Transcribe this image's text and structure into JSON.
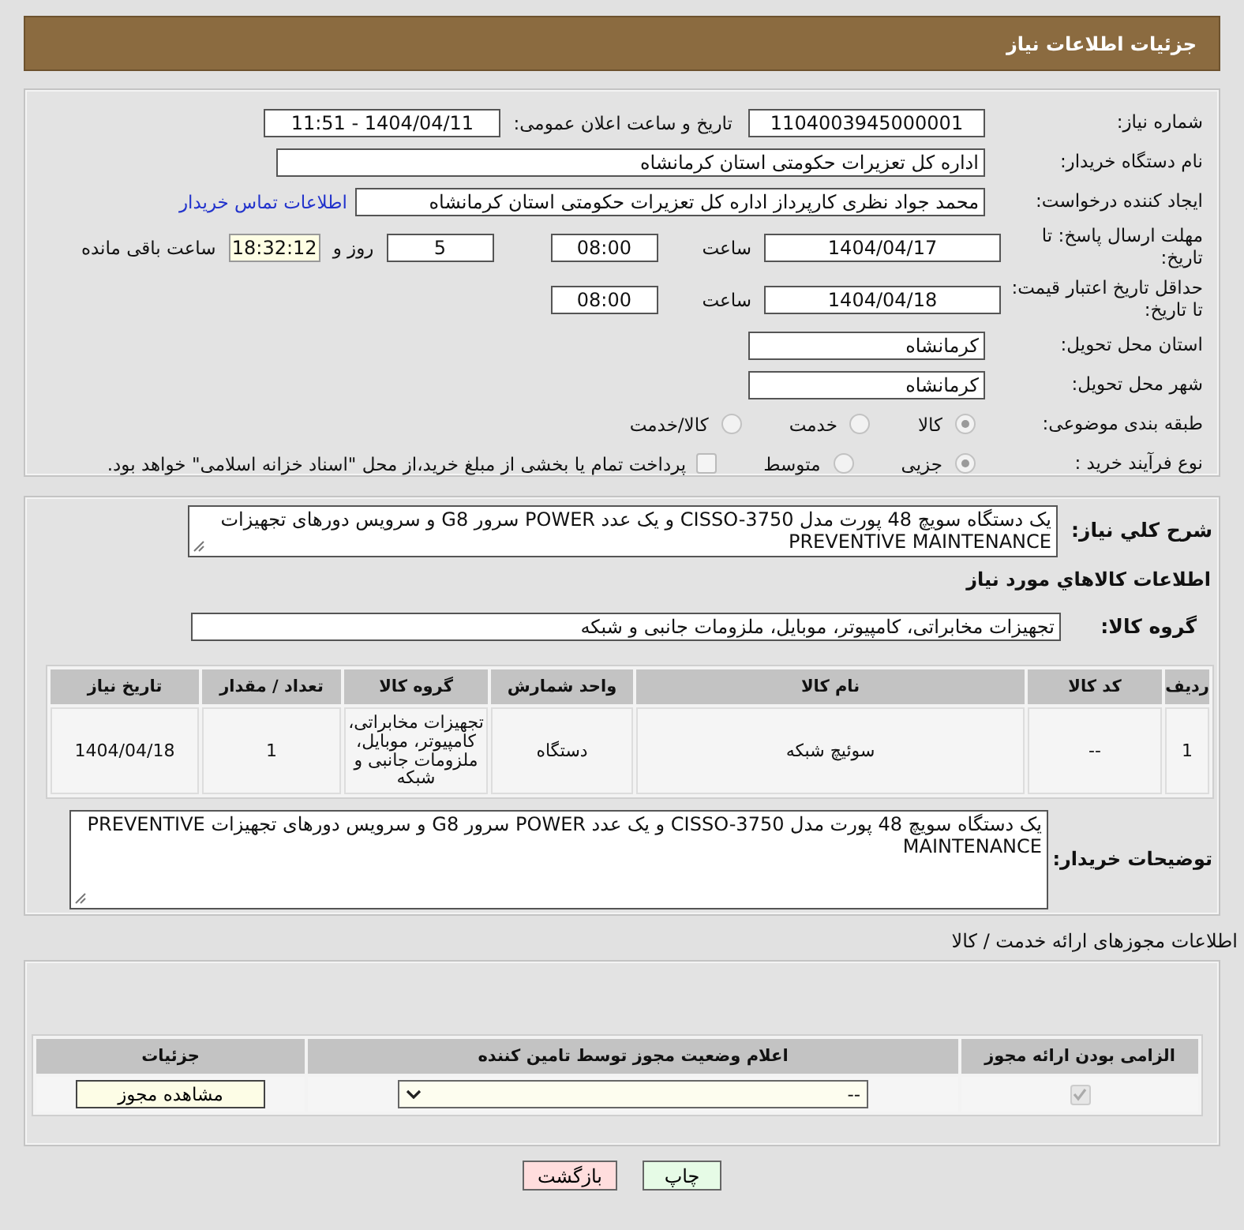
{
  "header": {
    "title": "جزئیات اطلاعات نیاز"
  },
  "need_number": {
    "label": "شماره نیاز:",
    "value": "1104003945000001"
  },
  "announce": {
    "label": "تاریخ و ساعت اعلان عمومی:",
    "value": "1404/04/11 - 11:51"
  },
  "buyer_org": {
    "label": "نام دستگاه خریدار:",
    "value": "اداره کل تعزیرات حکومتی استان کرمانشاه"
  },
  "requester": {
    "label": "ایجاد کننده درخواست:",
    "value": "محمد جواد نظری کارپرداز اداره کل تعزیرات حکومتی استان کرمانشاه",
    "link": "اطلاعات تماس خریدار"
  },
  "reply_deadline": {
    "label": "مهلت ارسال پاسخ: تا تاریخ:",
    "date": "1404/04/17",
    "time_label": "ساعت",
    "time": "08:00",
    "days": "5",
    "days_label": "روز و",
    "remaining": "18:32:12",
    "remaining_label": "ساعت باقی مانده"
  },
  "price_validity": {
    "label": "حداقل تاریخ اعتبار قیمت: تا تاریخ:",
    "date": "1404/04/18",
    "time_label": "ساعت",
    "time": "08:00"
  },
  "province": {
    "label": "استان محل تحویل:",
    "value": "کرمانشاه"
  },
  "city": {
    "label": "شهر محل تحویل:",
    "value": "کرمانشاه"
  },
  "category": {
    "label": "طبقه بندی موضوعی:",
    "options": [
      {
        "label": "کالا",
        "selected": true
      },
      {
        "label": "خدمت",
        "selected": false
      },
      {
        "label": "کالا/خدمت",
        "selected": false
      }
    ]
  },
  "process": {
    "label": "نوع فرآیند خرید :",
    "options": [
      {
        "label": "جزیی",
        "selected": true
      },
      {
        "label": "متوسط",
        "selected": false
      }
    ],
    "payment": {
      "text": "پرداخت تمام یا بخشی از مبلغ خرید،از محل \"اسناد خزانه اسلامی\" خواهد بود.",
      "checked": false
    }
  },
  "description": {
    "label": "شرح کلي نياز:",
    "value": "یک دستگاه سویچ 48 پورت مدل CISSO-3750 و یک عدد POWER سرور G8 و سرویس دورهای تجهیزات PREVENTIVE MAINTENANCE"
  },
  "items_title": "اطلاعات کالاهاي مورد نياز",
  "goods_group": {
    "label": "گروه کالا:",
    "value": "تجهیزات مخابراتی، کامپیوتر، موبایل، ملزومات جانبی و شبکه"
  },
  "items_table": {
    "columns": [
      "ردیف",
      "کد کالا",
      "نام کالا",
      "واحد شمارش",
      "گروه کالا",
      "تعداد / مقدار",
      "تاریخ نیاز"
    ],
    "rows": [
      [
        "1",
        "--",
        "سوئیچ شبکه",
        "دستگاه",
        "تجهیزات مخابراتی، کامپیوتر، موبایل، ملزومات جانبی و شبکه",
        "1",
        "1404/04/18"
      ]
    ]
  },
  "buyer_notes": {
    "label": "توضیحات خریدار:",
    "value": "یک دستگاه سویچ 48 پورت مدل CISSO-3750 و یک عدد POWER سرور G8 و سرویس دورهای تجهیزات  PREVENTIVE MAINTENANCE"
  },
  "licenses": {
    "title": "اطلاعات مجوزهای ارائه خدمت / کالا",
    "columns": [
      "الزامی بودن ارائه مجوز",
      "اعلام وضعیت مجوز توسط تامین کننده",
      "جزئیات"
    ],
    "rows": [
      {
        "required": true,
        "status": "--",
        "button": "مشاهده مجوز"
      }
    ]
  },
  "buttons": [
    {
      "label": "چاپ",
      "kind": "print"
    },
    {
      "label": "بازگشت",
      "kind": "back"
    }
  ]
}
